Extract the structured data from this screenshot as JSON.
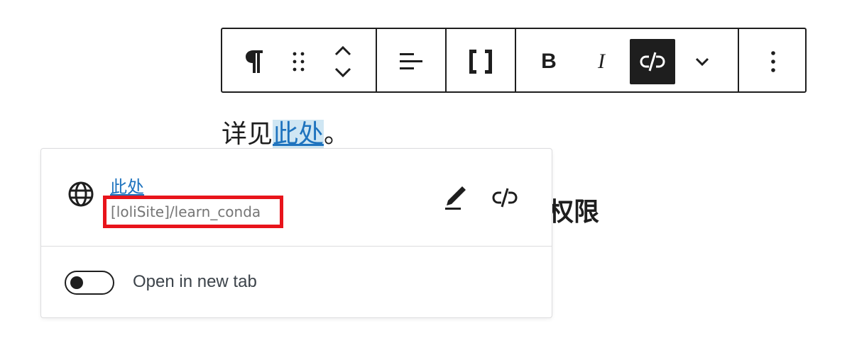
{
  "toolbar": {
    "paragraph_icon": "paragraph-icon",
    "drag_icon": "drag-handle-icon",
    "move_icon": "move-up-down-icon",
    "align_icon": "align-icon",
    "shortcode_icon": "brackets-icon",
    "bold_label": "B",
    "italic_label": "I",
    "unlink_icon": "unlink-icon",
    "more_format_icon": "chevron-down-icon",
    "options_icon": "more-vertical-icon"
  },
  "paragraph": {
    "prefix": "详见",
    "link_text": "此处",
    "suffix": "。"
  },
  "background_heading": "设置权限",
  "link_popover": {
    "title": "此处",
    "url": "[loliSite]/learn_conda",
    "edit_icon": "pencil-icon",
    "unlink_icon": "unlink-icon",
    "globe_icon": "globe-icon",
    "open_in_new_tab_label": "Open in new tab",
    "open_in_new_tab_checked": false
  },
  "colors": {
    "link": "#1e73be",
    "highlight": "#e8141b",
    "active_toolbar": "#1e1e1e"
  }
}
